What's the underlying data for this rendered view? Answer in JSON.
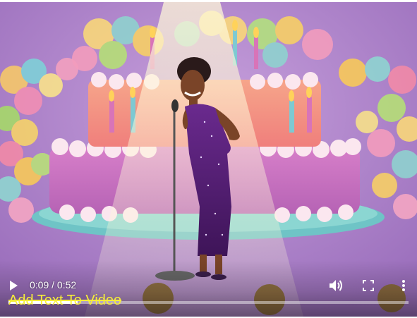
{
  "video": {
    "current_time": "0:09",
    "separator": " / ",
    "duration": "0:52",
    "progress_fraction": 0.173,
    "overlay_caption": "Add Text To Video",
    "caption_color": "#f6ee3a"
  },
  "controls": {
    "play_icon": "play-icon",
    "volume_icon": "volume-icon",
    "fullscreen_icon": "fullscreen-icon",
    "more_icon": "more-vertical-icon"
  },
  "scene": {
    "subject": "cartoon singer at microphone in front of birthday cake",
    "background_color": "#a77cc6"
  }
}
